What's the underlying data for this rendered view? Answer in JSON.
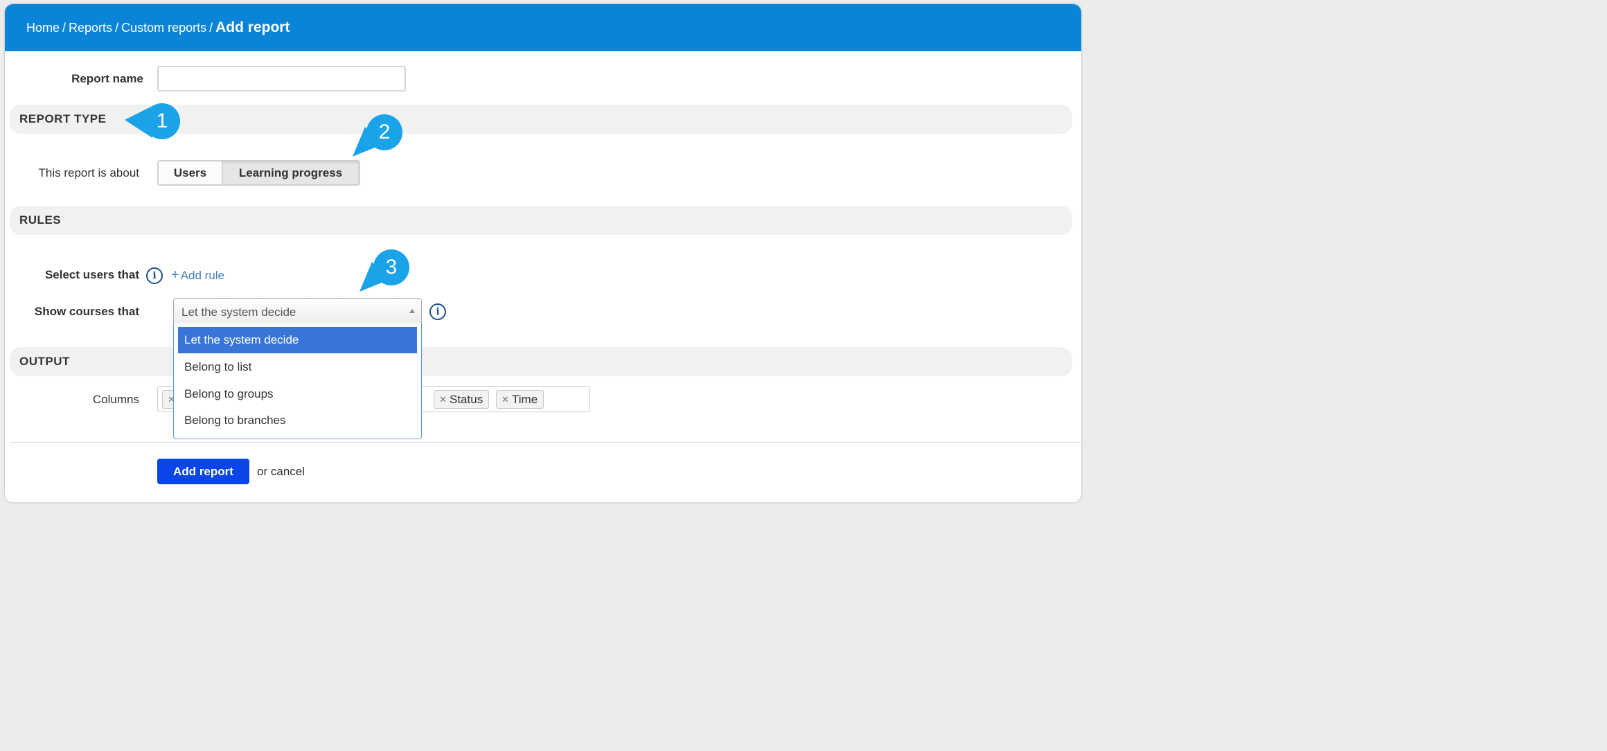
{
  "breadcrumb": {
    "home": "Home",
    "reports": "Reports",
    "custom_reports": "Custom reports",
    "current": "Add report",
    "separator": "/"
  },
  "form": {
    "report_name_label": "Report name",
    "report_name_value": "",
    "report_type_section": "REPORT TYPE",
    "about_label": "This report is about",
    "about_options": [
      "Users",
      "Learning progress"
    ],
    "about_selected": "Learning progress",
    "rules_section": "RULES",
    "select_users_label": "Select users that",
    "add_rule_label": "Add rule",
    "show_courses_label": "Show courses that",
    "show_courses_value": "Let the system decide",
    "show_courses_options": [
      "Let the system decide",
      "Belong to list",
      "Belong to groups",
      "Belong to branches"
    ],
    "output_section": "OUTPUT",
    "columns_label": "Columns",
    "column_tags": [
      "Status",
      "Time"
    ]
  },
  "actions": {
    "submit_label": "Add report",
    "or_text": "or",
    "cancel_label": "cancel"
  },
  "callouts": [
    "1",
    "2",
    "3"
  ],
  "icons": {
    "info": "info-icon",
    "remove": "remove-tag-icon",
    "caret": "caret-up-icon"
  },
  "colors": {
    "header": "#0a84d6",
    "primary_button": "#0a45e8",
    "callout": "#1aa3e8",
    "highlight": "#3875d7"
  }
}
